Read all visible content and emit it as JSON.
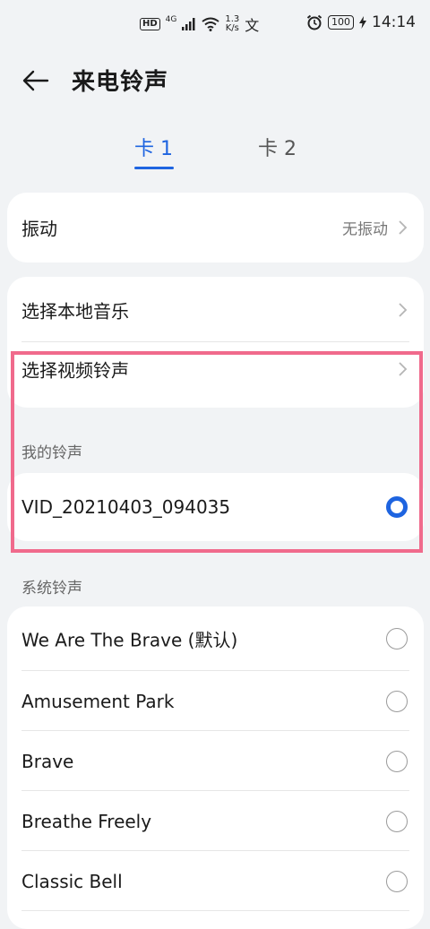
{
  "status_bar": {
    "hd": "HD",
    "network": "4G",
    "speed_value": "1.3",
    "speed_unit": "K/s",
    "battery": "100",
    "time": "14:14"
  },
  "header": {
    "title": "来电铃声"
  },
  "tabs": [
    {
      "label": "卡 1",
      "selected": true
    },
    {
      "label": "卡 2",
      "selected": false
    }
  ],
  "vibration": {
    "label": "振动",
    "value": "无振动"
  },
  "sources": {
    "local_music": "选择本地音乐",
    "video_ringtone": "选择视频铃声"
  },
  "my_ringtones": {
    "section_label": "我的铃声",
    "items": [
      {
        "name": "VID_20210403_094035",
        "selected": true
      }
    ]
  },
  "system_ringtones": {
    "section_label": "系统铃声",
    "items": [
      {
        "name": "We Are The Brave (默认)",
        "selected": false
      },
      {
        "name": "Amusement Park",
        "selected": false
      },
      {
        "name": "Brave",
        "selected": false
      },
      {
        "name": "Breathe Freely",
        "selected": false
      },
      {
        "name": "Classic Bell",
        "selected": false
      }
    ]
  },
  "colors": {
    "accent": "#1e64e0",
    "highlight": "#f06a8c",
    "background": "#f1f3f5"
  }
}
